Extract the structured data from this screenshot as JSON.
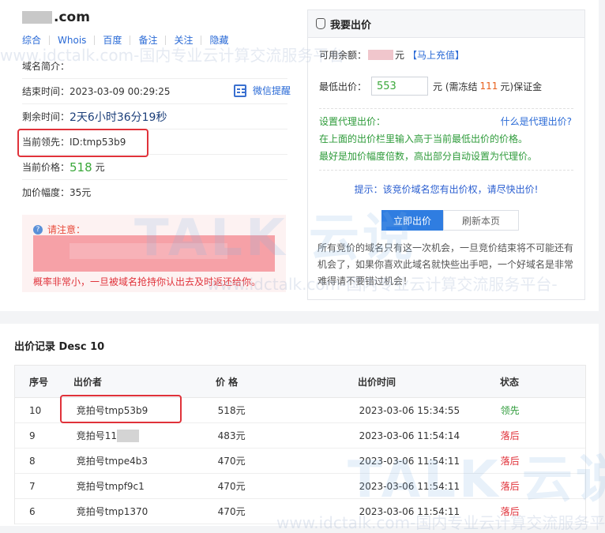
{
  "domain": {
    "suffix": ".com"
  },
  "links": [
    "综合",
    "Whois",
    "百度",
    "备注",
    "关注",
    "隐藏"
  ],
  "info": {
    "intro_label": "域名简介：",
    "end_label": "结束时间：",
    "end_value": "2023-03-09 00:29:25",
    "wechat_label": "微信提醒",
    "remain_label": "剩余时间：",
    "remain_value": "2天6小时36分19秒",
    "leader_label": "当前领先：",
    "leader_value": "ID:tmp53b9",
    "price_label": "当前价格：",
    "price_value": "518",
    "price_unit": "元",
    "incr_label": "加价幅度：",
    "incr_value": "35元"
  },
  "notice": {
    "title": "请注意：",
    "text": "概率非常小，一旦被域名抢持你认出去及时返还给你。"
  },
  "bid_panel": {
    "title": "我要出价",
    "balance_label": "可用余额：",
    "balance_unit": "元",
    "recharge": "【马上充值】",
    "min_label": "最低出价：",
    "min_value": "553",
    "deposit_pre": "元 (需冻结",
    "deposit_value": "111",
    "deposit_post": "元)保证金",
    "proxy_label": "设置代理出价：",
    "proxy_link": "什么是代理出价?",
    "proxy_line1": "在上面的出价栏里输入高于当前最低出价的价格。",
    "proxy_line2": "最好是加价幅度倍数，高出部分自动设置为代理价。",
    "tip": "提示：该竞价域名您有出价权，请尽快出价!",
    "bid_button": "立即出价",
    "refresh_button": "刷新本页",
    "description": "所有竞价的域名只有这一次机会，一旦竞价结束将不可能还有机会了，如果你喜欢此域名就快些出手吧，一个好域名是非常难得请不要错过机会！"
  },
  "records": {
    "title": "出价记录 Desc 10",
    "headers": [
      "序号",
      "出价者",
      "价 格",
      "出价时间",
      "状态"
    ],
    "rows": [
      {
        "no": "10",
        "bidder": "竞拍号tmp53b9",
        "price": "518元",
        "time": "2023-03-06 15:34:55",
        "status": "领先"
      },
      {
        "no": "9",
        "bidder": "竞拍号11",
        "price": "483元",
        "time": "2023-03-06 11:54:14",
        "status": "落后"
      },
      {
        "no": "8",
        "bidder": "竞拍号tmpe4b3",
        "price": "470元",
        "time": "2023-03-06 11:54:11",
        "status": "落后"
      },
      {
        "no": "7",
        "bidder": "竞拍号tmpf9c1",
        "price": "470元",
        "time": "2023-03-06 11:54:11",
        "status": "落后"
      },
      {
        "no": "6",
        "bidder": "竞拍号tmp1370",
        "price": "470元",
        "time": "2023-03-06 11:54:11",
        "status": "落后"
      }
    ]
  },
  "watermark": {
    "small": "www.idctalk.com-国内专业云计算交流服务平台-",
    "big": "TALK 云说"
  },
  "colors": {
    "accent": "#2f7de1",
    "lead": "#2e9b3a",
    "lag": "#e0323a",
    "highlight": "#e0323a"
  }
}
